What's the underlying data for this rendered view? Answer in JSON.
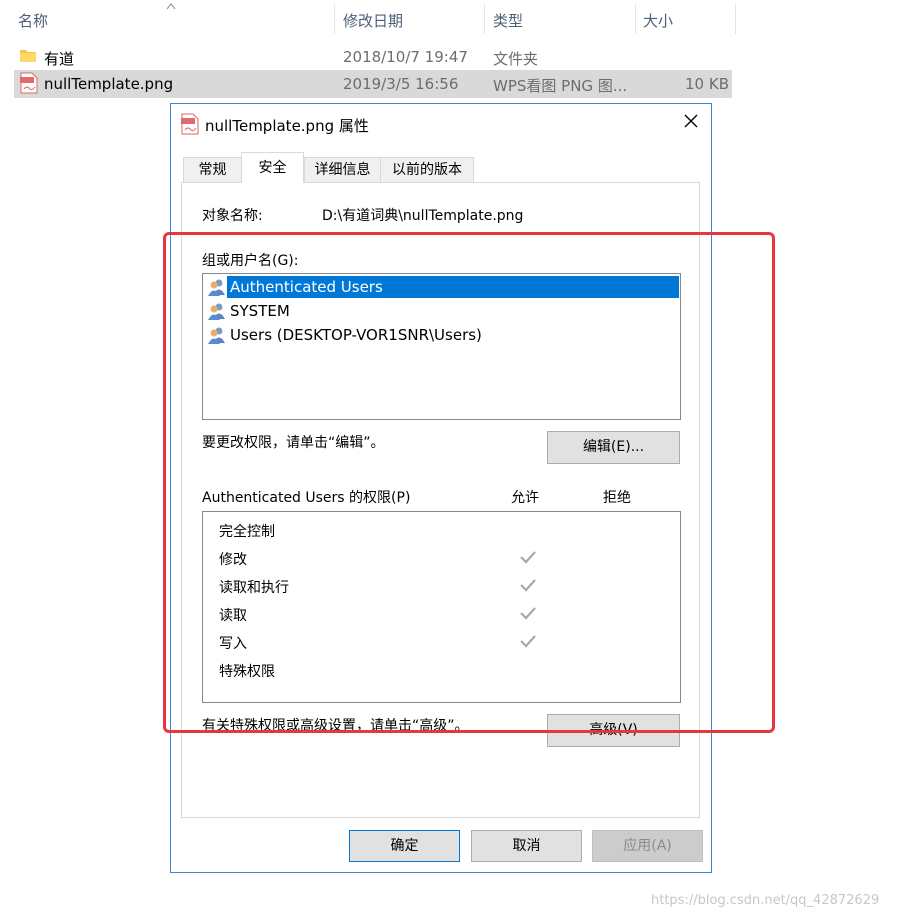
{
  "explorer": {
    "columns": [
      "名称",
      "修改日期",
      "类型",
      "大小"
    ],
    "rows": [
      {
        "name": "有道",
        "date": "2018/10/7 19:47",
        "type": "文件夹",
        "size": ""
      },
      {
        "name": "nullTemplate.png",
        "date": "2019/3/5 16:56",
        "type": "WPS看图 PNG 图...",
        "size": "10 KB"
      }
    ]
  },
  "dialog": {
    "title": "nullTemplate.png 属性",
    "tabs": [
      "常规",
      "安全",
      "详细信息",
      "以前的版本"
    ],
    "active_tab": "安全",
    "object_label": "对象名称:",
    "object_value": "D:\\有道词典\\nullTemplate.png",
    "group_label": "组或用户名(G):",
    "users": [
      "Authenticated Users",
      "SYSTEM",
      "Users (DESKTOP-VOR1SNR\\Users)"
    ],
    "selected_user_index": 0,
    "edit_hint": "要更改权限，请单击“编辑”。",
    "edit_button": "编辑(E)...",
    "perm_header": "Authenticated Users 的权限(P)",
    "allow_label": "允许",
    "deny_label": "拒绝",
    "permissions": [
      {
        "name": "完全控制",
        "allow": false
      },
      {
        "name": "修改",
        "allow": true
      },
      {
        "name": "读取和执行",
        "allow": true
      },
      {
        "name": "读取",
        "allow": true
      },
      {
        "name": "写入",
        "allow": true
      },
      {
        "name": "特殊权限",
        "allow": false
      }
    ],
    "advanced_hint": "有关特殊权限或高级设置，请单击“高级”。",
    "advanced_button": "高级(V)",
    "ok_button": "确定",
    "cancel_button": "取消",
    "apply_button": "应用(A)"
  },
  "watermark": "https://blog.csdn.net/qq_42872629",
  "colors": {
    "selection": "#0078d7",
    "highlight_box": "#e8363a",
    "dialog_border": "#3b87d5"
  }
}
